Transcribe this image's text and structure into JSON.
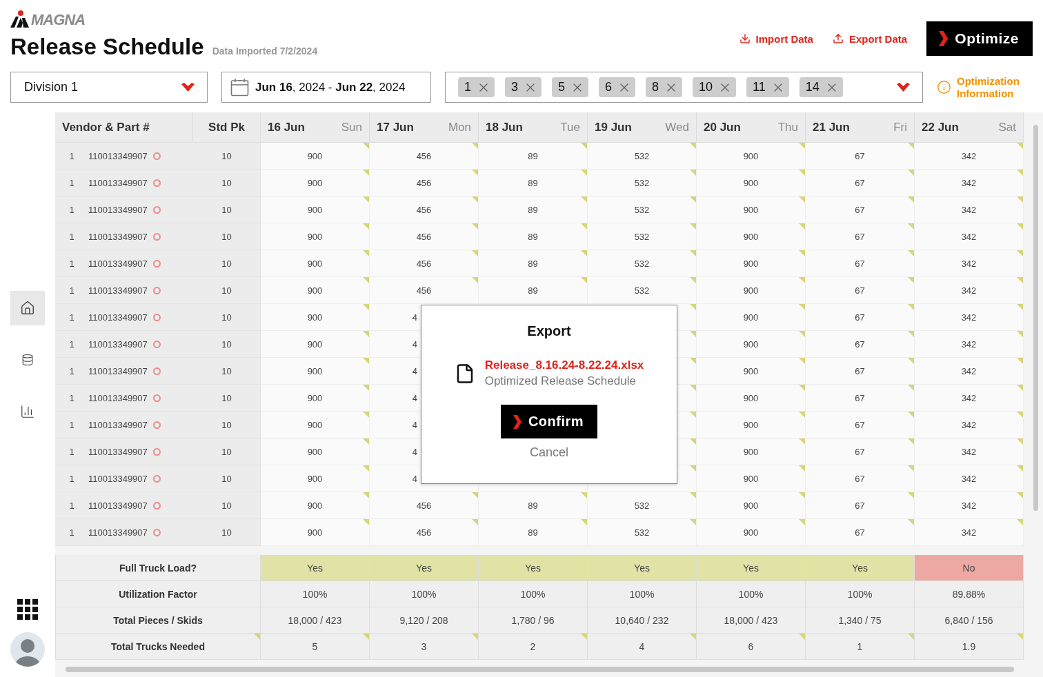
{
  "logo": {
    "text": "MAGNA"
  },
  "header": {
    "title": "Release Schedule",
    "subtitle": "Data Imported 7/2/2024",
    "actions": [
      {
        "label": "Import Data",
        "kind": "import"
      },
      {
        "label": "Export Data",
        "kind": "export"
      }
    ],
    "primary": {
      "label": "Optimize"
    }
  },
  "filters": {
    "division": {
      "value": "Division 1"
    },
    "date_range": {
      "value": "**Jun 16**, 2024 - **Jun 22**, 2024"
    },
    "tags": [
      "1",
      "3",
      "5",
      "6",
      "8",
      "10",
      "11",
      "14"
    ],
    "info_link": {
      "lines": [
        "Optimization",
        "Information"
      ]
    }
  },
  "sidebar": {
    "items": [
      {
        "kind": "home",
        "selected": true
      },
      {
        "kind": "database",
        "selected": false
      },
      {
        "kind": "chart",
        "selected": false
      }
    ]
  },
  "table": {
    "columns": [
      {
        "label": "Vendor & Part #"
      },
      {
        "label": "Std Pk"
      }
    ],
    "days": [
      {
        "date": "16 Jun",
        "weekday": "Sun"
      },
      {
        "date": "17 Jun",
        "weekday": "Mon"
      },
      {
        "date": "18 Jun",
        "weekday": "Tue"
      },
      {
        "date": "19 Jun",
        "weekday": "Wed"
      },
      {
        "date": "20 Jun",
        "weekday": "Thu"
      },
      {
        "date": "21 Jun",
        "weekday": "Fri"
      },
      {
        "date": "22 Jun",
        "weekday": "Sat"
      }
    ],
    "rows": [
      {
        "number": "1",
        "part": "110013349907",
        "std_pk": "10",
        "cells": [
          "900",
          "456",
          "89",
          "532",
          "900",
          "67",
          "342"
        ]
      },
      {
        "number": "1",
        "part": "110013349907",
        "std_pk": "10",
        "cells": [
          "900",
          "456",
          "89",
          "532",
          "900",
          "67",
          "342"
        ]
      },
      {
        "number": "1",
        "part": "110013349907",
        "std_pk": "10",
        "cells": [
          "900",
          "456",
          "89",
          "532",
          "900",
          "67",
          "342"
        ]
      },
      {
        "number": "1",
        "part": "110013349907",
        "std_pk": "10",
        "cells": [
          "900",
          "456",
          "89",
          "532",
          "900",
          "67",
          "342"
        ]
      },
      {
        "number": "1",
        "part": "110013349907",
        "std_pk": "10",
        "cells": [
          "900",
          "456",
          "89",
          "532",
          "900",
          "67",
          "342"
        ]
      },
      {
        "number": "1",
        "part": "110013349907",
        "std_pk": "10",
        "cells": [
          "900",
          "456",
          "89",
          "532",
          "900",
          "67",
          "342"
        ]
      },
      {
        "number": "1",
        "part": "110013349907",
        "std_pk": "10",
        "cells": [
          "900",
          "4",
          null,
          null,
          "900",
          "67",
          "342"
        ]
      },
      {
        "number": "1",
        "part": "110013349907",
        "std_pk": "10",
        "cells": [
          "900",
          "4",
          null,
          null,
          "900",
          "67",
          "342"
        ]
      },
      {
        "number": "1",
        "part": "110013349907",
        "std_pk": "10",
        "cells": [
          "900",
          "4",
          null,
          null,
          "900",
          "67",
          "342"
        ]
      },
      {
        "number": "1",
        "part": "110013349907",
        "std_pk": "10",
        "cells": [
          "900",
          "4",
          null,
          null,
          "900",
          "67",
          "342"
        ]
      },
      {
        "number": "1",
        "part": "110013349907",
        "std_pk": "10",
        "cells": [
          "900",
          "4",
          null,
          null,
          "900",
          "67",
          "342"
        ]
      },
      {
        "number": "1",
        "part": "110013349907",
        "std_pk": "10",
        "cells": [
          "900",
          "4",
          null,
          null,
          "900",
          "67",
          "342"
        ]
      },
      {
        "number": "1",
        "part": "110013349907",
        "std_pk": "10",
        "cells": [
          "900",
          "4",
          null,
          null,
          "900",
          "67",
          "342"
        ]
      },
      {
        "number": "1",
        "part": "110013349907",
        "std_pk": "10",
        "cells": [
          "900",
          "456",
          "89",
          "532",
          "900",
          "67",
          "342"
        ]
      },
      {
        "number": "1",
        "part": "110013349907",
        "std_pk": "10",
        "cells": [
          "900",
          "456",
          "89",
          "532",
          "900",
          "67",
          "342"
        ]
      }
    ],
    "summary": [
      {
        "label": "Full Truck Load?",
        "kind": "status",
        "cells": [
          {
            "text": "Yes",
            "ok": true
          },
          {
            "text": "Yes",
            "ok": true
          },
          {
            "text": "Yes",
            "ok": true
          },
          {
            "text": "Yes",
            "ok": true
          },
          {
            "text": "Yes",
            "ok": true
          },
          {
            "text": "Yes",
            "ok": true
          },
          {
            "text": "No",
            "ok": false
          }
        ]
      },
      {
        "label": "Utilization Factor",
        "kind": "plain",
        "cells": [
          "100%",
          "100%",
          "100%",
          "100%",
          "100%",
          "100%",
          "89.88%"
        ]
      },
      {
        "label": "Total Pieces / Skids",
        "kind": "plain",
        "cells": [
          "18,000 / 423",
          "9,120 / 208",
          "1,780 / 96",
          "10,640 / 232",
          "18,000 / 423",
          "1,340 / 75",
          "6,840 / 156"
        ]
      },
      {
        "label": "Total Trucks Needed",
        "kind": "flagged",
        "cells": [
          "5",
          "3",
          "2",
          "4",
          "6",
          "1",
          "1.9"
        ]
      }
    ]
  },
  "dialog": {
    "title": "Export",
    "file_name": "Release_8.16.24-8.22.24.xlsx",
    "file_description": "Optimized Release Schedule",
    "confirm": "Confirm",
    "cancel": "Cancel"
  }
}
